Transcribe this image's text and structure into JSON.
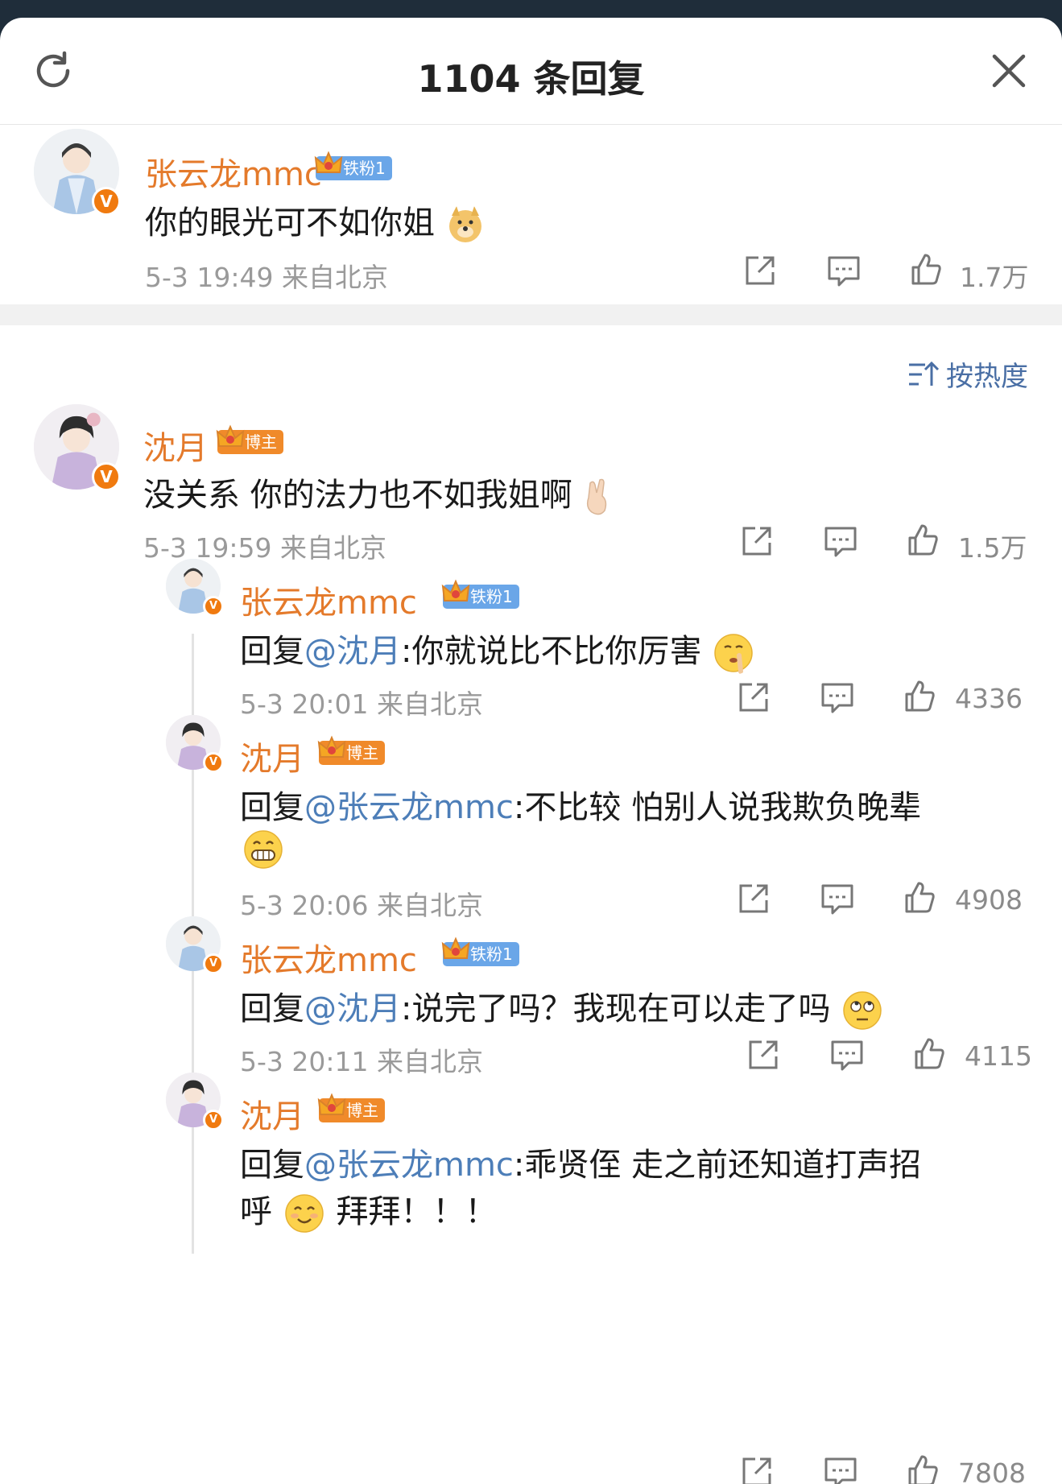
{
  "header": {
    "title": "1104 条回复"
  },
  "main_comment": {
    "username": "张云龙mmc",
    "badge": "铁粉1",
    "text": "你的眼光可不如你姐",
    "time_location": "5-3 19:49  来自北京",
    "likes": "1.7万"
  },
  "sort": {
    "label": "按热度"
  },
  "replies": [
    {
      "username": "沈月",
      "badge": "博主",
      "text": "没关系 你的法力也不如我姐啊",
      "time_location": "5-3 19:59  来自北京",
      "likes": "1.5万"
    },
    {
      "username": "张云龙mmc",
      "badge": "铁粉1",
      "prefix": "回复",
      "at": "@沈月",
      "text": ":你就说比不比你厉害",
      "time_location": "5-3 20:01  来自北京",
      "likes": "4336"
    },
    {
      "username": "沈月",
      "badge": "博主",
      "prefix": "回复",
      "at": "@张云龙mmc",
      "text": ":不比较 怕别人说我欺负晚辈",
      "time_location": "5-3 20:06  来自北京",
      "likes": "4908"
    },
    {
      "username": "张云龙mmc",
      "badge": "铁粉1",
      "prefix": "回复",
      "at": "@沈月",
      "text": ":说完了吗？我现在可以走了吗",
      "time_location": "5-3 20:11  来自北京",
      "likes": "4115"
    },
    {
      "username": "沈月",
      "badge": "博主",
      "prefix": "回复",
      "at": "@张云龙mmc",
      "text": ":乖贤侄 走之前还知道打声招",
      "text_line2": "呼",
      "text_line2_tail": "拜拜！！！",
      "likes": "7808"
    }
  ],
  "colors": {
    "username": "#e47a2b",
    "mention": "#4d7eb8",
    "fan_badge": "#6aa6e8",
    "host_badge": "#f08a2a",
    "verified": "#f07a0f"
  },
  "icons": [
    "refresh-icon",
    "close-icon",
    "share-icon",
    "comment-icon",
    "like-icon",
    "sort-icon",
    "crown-icon",
    "verified-icon"
  ]
}
